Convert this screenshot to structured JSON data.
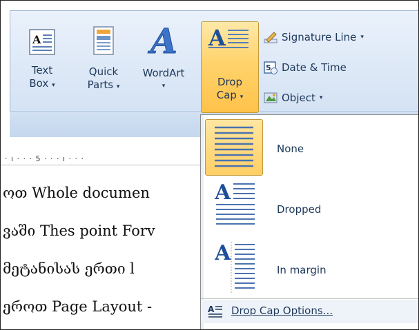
{
  "ribbon": {
    "text_box": {
      "line1": "Text",
      "line2": "Box",
      "caret": "▾"
    },
    "quick_parts": {
      "line1": "Quick",
      "line2": "Parts",
      "caret": "▾"
    },
    "wordart": {
      "line1": "WordArt",
      "caret": "▾"
    },
    "drop_cap": {
      "line1": "Drop",
      "line2": "Cap",
      "caret": "▾"
    },
    "signature_line": {
      "label": "Signature Line",
      "caret": "▾"
    },
    "date_time": {
      "label": "Date & Time"
    },
    "object": {
      "label": "Object",
      "caret": "▾"
    }
  },
  "ruler": {
    "text": "· ı · · · 5 · · · ı · · ·"
  },
  "document": {
    "lines": [
      "ოთ  Whole documen",
      "ვაში  Thes point Forv",
      "მეტანისას  ერთი  l",
      "ეროთ  Page Layout -"
    ]
  },
  "dropdown": {
    "items": [
      {
        "label": "None",
        "selected": true
      },
      {
        "label": "Dropped",
        "selected": false
      },
      {
        "label": "In margin",
        "selected": false
      }
    ],
    "options_label": "Drop Cap Options..."
  },
  "colors": {
    "accent": "#ffc24a",
    "text": "#1e395b",
    "ribbon": "#dbe7f6"
  }
}
